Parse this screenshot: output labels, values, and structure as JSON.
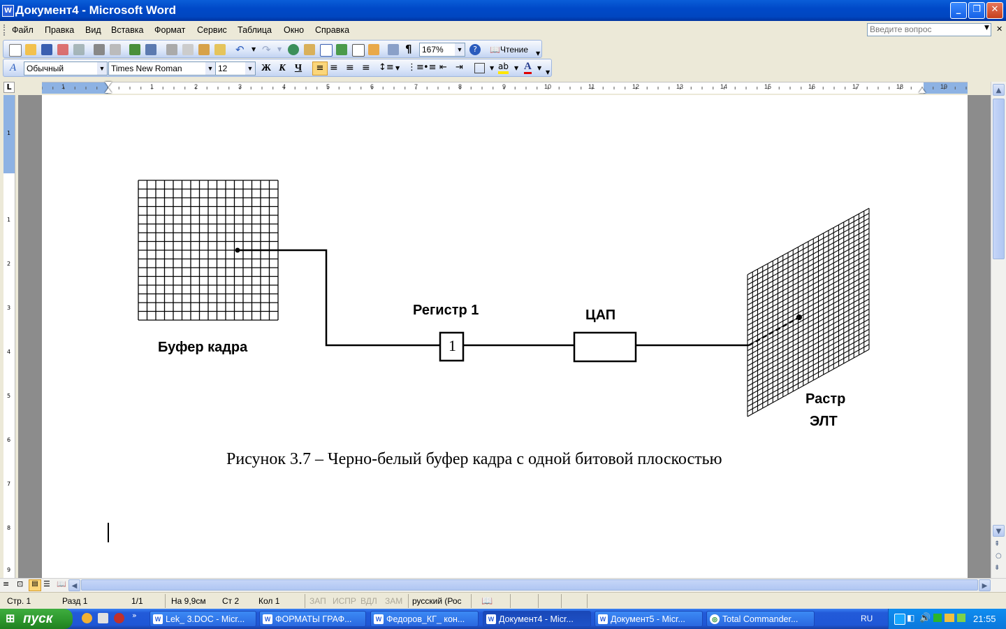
{
  "window": {
    "title": "Документ4 - Microsoft Word",
    "app_icon": "W"
  },
  "menu": [
    "Файл",
    "Правка",
    "Вид",
    "Вставка",
    "Формат",
    "Сервис",
    "Таблица",
    "Окно",
    "Справка"
  ],
  "ask_placeholder": "Введите вопрос",
  "toolbar": {
    "zoom": "167%",
    "reading_label": "Чтение"
  },
  "formatting": {
    "style": "Обычный",
    "font": "Times New Roman",
    "size": "12",
    "bold": "Ж",
    "italic": "К",
    "underline": "Ч"
  },
  "ruler_numbers": [
    "1",
    "1",
    "2",
    "3",
    "4",
    "5",
    "6",
    "7",
    "8",
    "9",
    "10",
    "11",
    "12",
    "13",
    "14",
    "15",
    "16",
    "17",
    "18",
    "19"
  ],
  "vruler_numbers": [
    "1",
    "1",
    "2",
    "3",
    "4",
    "5",
    "6",
    "7",
    "8",
    "9"
  ],
  "figure": {
    "buffer_label": "Буфер кадра",
    "register_label": "Регистр 1",
    "register_value": "1",
    "dac_label": "ЦАП",
    "raster_label_1": "Растр",
    "raster_label_2": "ЭЛТ",
    "caption": "Рисунок 3.7 – Черно-белый буфер кадра с одной битовой плоскостью"
  },
  "status": {
    "page": "Стр. 1",
    "section": "Разд 1",
    "pages": "1/1",
    "at": "На 9,9см",
    "line": "Ст 2",
    "col": "Кол 1",
    "rec": "ЗАП",
    "trk": "ИСПР",
    "ext": "ВДЛ",
    "ovr": "ЗАМ",
    "lang": "русский (Рос"
  },
  "taskbar": {
    "start": "пуск",
    "tasks": [
      "Lek_ 3.DOC - Micr...",
      "ФОРМАТЫ ГРАФ...",
      "Федоров_КГ_ кон...",
      "Документ4 - Micr...",
      "Документ5 - Micr...",
      "Total Commander..."
    ],
    "lang": "RU",
    "clock": "21:55"
  }
}
